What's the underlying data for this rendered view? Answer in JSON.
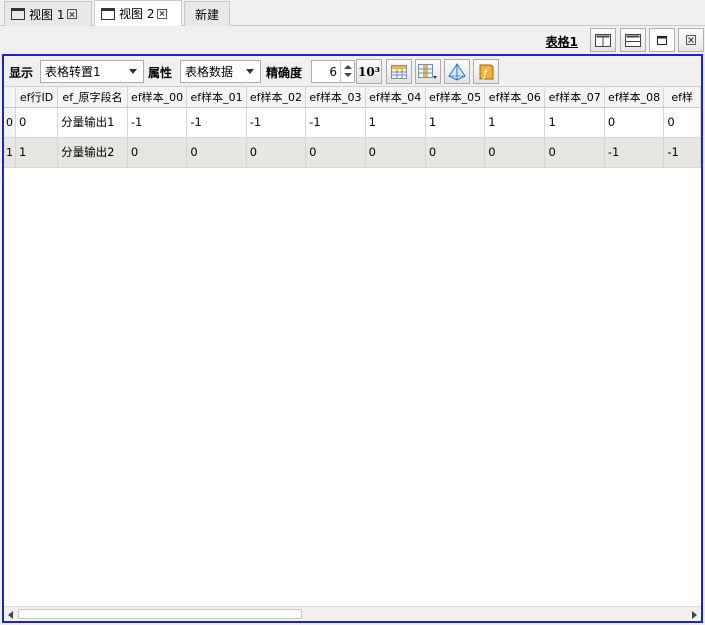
{
  "tabs": [
    {
      "label": "视图 1",
      "closable": true,
      "active": false
    },
    {
      "label": "视图 2",
      "closable": true,
      "active": true
    },
    {
      "label": "新建",
      "closable": false,
      "active": false
    }
  ],
  "panel": {
    "title": "表格1"
  },
  "toolbar": {
    "display_label": "显示",
    "display_value": "表格转置1",
    "property_label": "属性",
    "property_value": "表格数据",
    "precision_label": "精确度",
    "precision_value": "6",
    "sci_button_label": "10³"
  },
  "table": {
    "columns": [
      "",
      "ef行ID",
      "ef_原字段名",
      "ef样本_00",
      "ef样本_01",
      "ef样本_02",
      "ef样本_03",
      "ef样本_04",
      "ef样本_05",
      "ef样本_06",
      "ef样本_07",
      "ef样本_08",
      "ef样"
    ],
    "rows": [
      [
        "0",
        "0",
        "分量输出1",
        "-1",
        "-1",
        "-1",
        "-1",
        "1",
        "1",
        "1",
        "1",
        "0",
        "0"
      ],
      [
        "1",
        "1",
        "分量输出2",
        "0",
        "0",
        "0",
        "0",
        "0",
        "0",
        "0",
        "0",
        "-1",
        "-1"
      ]
    ]
  },
  "colors": {
    "frame_border": "#1e22c8",
    "alt_row": "#e8e6e2"
  }
}
